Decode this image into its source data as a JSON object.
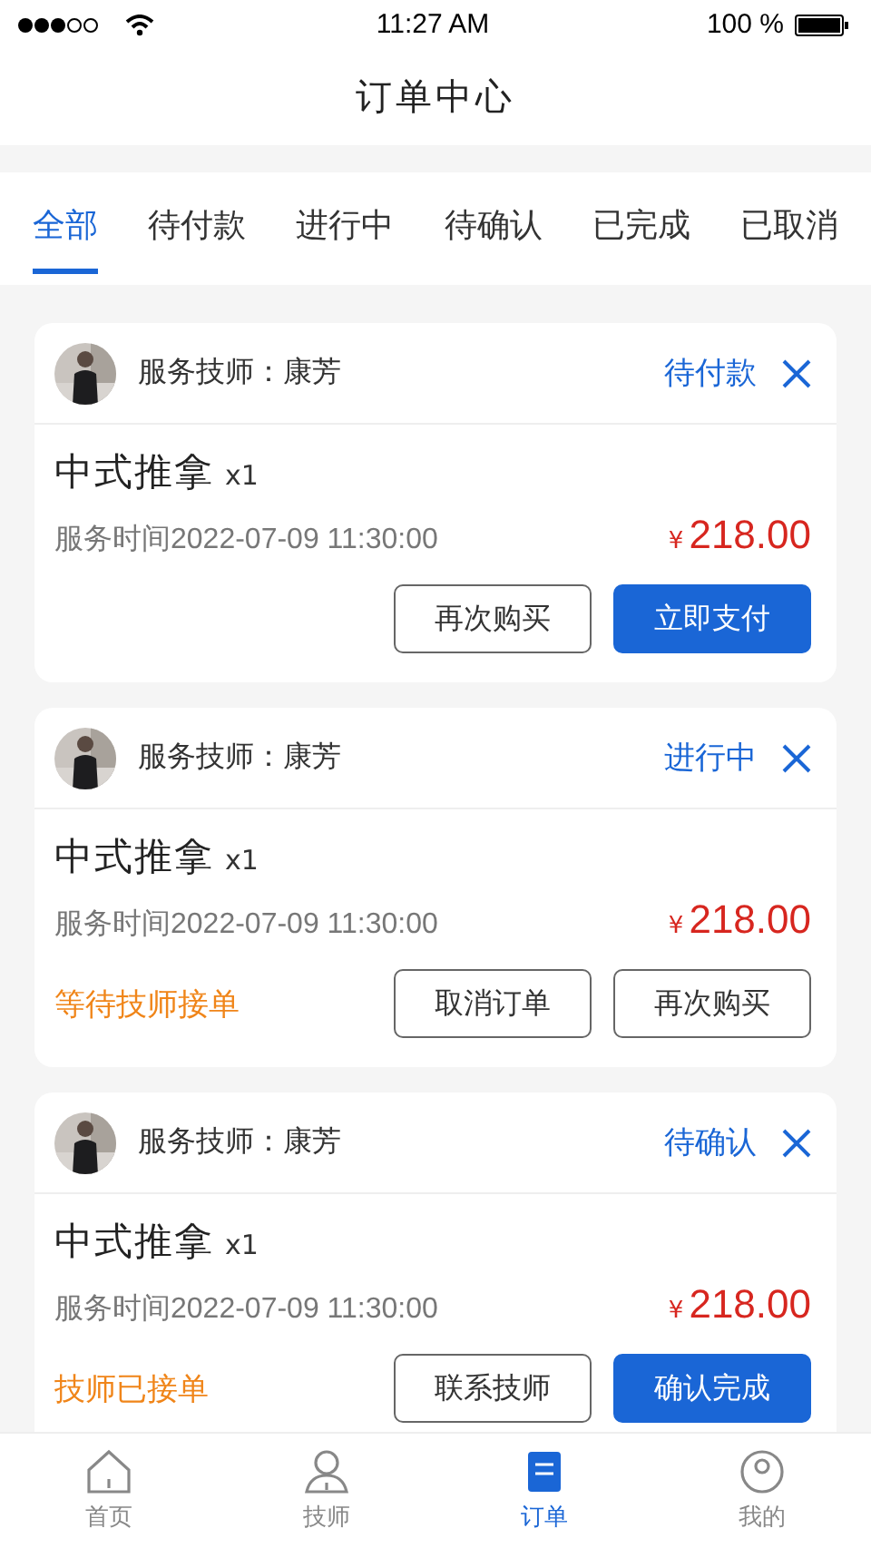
{
  "status_bar": {
    "time": "11:27 AM",
    "battery": "100 %"
  },
  "header": {
    "title": "订单中心"
  },
  "tabs": [
    {
      "label": "全部",
      "selected": true
    },
    {
      "label": "待付款",
      "selected": false
    },
    {
      "label": "进行中",
      "selected": false
    },
    {
      "label": "待确认",
      "selected": false
    },
    {
      "label": "已完成",
      "selected": false
    },
    {
      "label": "已取消",
      "selected": false
    }
  ],
  "orders": [
    {
      "technician": "服务技师：康芳",
      "status": "待付款",
      "service": "中式推拿",
      "quantity": "x1",
      "time": "服务时间2022-07-09 11:30:00",
      "currency": "¥",
      "price": "218.00",
      "buttons": [
        {
          "label": "再次购买",
          "kind": "outline"
        },
        {
          "label": "立即支付",
          "kind": "primary"
        }
      ]
    },
    {
      "technician": "服务技师：康芳",
      "status": "进行中",
      "service": "中式推拿",
      "quantity": "x1",
      "time": "服务时间2022-07-09 11:30:00",
      "currency": "¥",
      "price": "218.00",
      "note": "等待技师接单",
      "buttons": [
        {
          "label": "取消订单",
          "kind": "outline"
        },
        {
          "label": "再次购买",
          "kind": "outline"
        }
      ]
    },
    {
      "technician": "服务技师：康芳",
      "status": "待确认",
      "service": "中式推拿",
      "quantity": "x1",
      "time": "服务时间2022-07-09 11:30:00",
      "currency": "¥",
      "price": "218.00",
      "note": "技师已接单",
      "buttons": [
        {
          "label": "联系技师",
          "kind": "outline"
        },
        {
          "label": "确认完成",
          "kind": "primary"
        }
      ]
    }
  ],
  "tab_bar": [
    {
      "label": "首页",
      "kind": "home",
      "selected": false
    },
    {
      "label": "技师",
      "kind": "person",
      "selected": false
    },
    {
      "label": "订单",
      "kind": "order",
      "selected": true
    },
    {
      "label": "我的",
      "kind": "me",
      "selected": false
    }
  ]
}
